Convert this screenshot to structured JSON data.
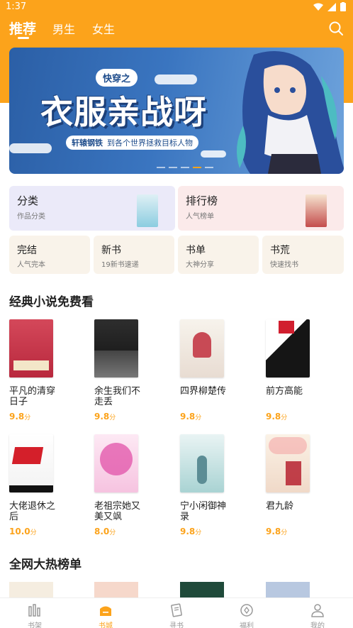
{
  "status_bar": {
    "time": "1:37"
  },
  "top_tabs": [
    {
      "label": "推荐",
      "active": true
    },
    {
      "label": "男生",
      "active": false
    },
    {
      "label": "女生",
      "active": false
    }
  ],
  "banner": {
    "tag": "快穿之",
    "title": "衣服亲战呀",
    "author": "轩辕钢铁",
    "tagline": "到各个世界拯救目标人物"
  },
  "categories": [
    {
      "name": "分类",
      "sub": "作品分类"
    },
    {
      "name": "排行榜",
      "sub": "人气榜单"
    },
    {
      "name": "完结",
      "sub": "人气完本"
    },
    {
      "name": "新书",
      "sub": "19新书速递"
    },
    {
      "name": "书单",
      "sub": "大神分享"
    },
    {
      "name": "书荒",
      "sub": "快速找书"
    }
  ],
  "section1": {
    "title": "经典小说免费看",
    "books": [
      {
        "title": "平凡的清穿日子",
        "score": "9.8",
        "unit": "分"
      },
      {
        "title": "余生我们不走丢",
        "score": "9.8",
        "unit": "分"
      },
      {
        "title": "四界柳楚传",
        "score": "9.8",
        "unit": "分"
      },
      {
        "title": "前方高能",
        "score": "9.8",
        "unit": "分"
      },
      {
        "title": "大佬退休之后",
        "score": "10.0",
        "unit": "分"
      },
      {
        "title": "老祖宗她又美又飒",
        "score": "8.0",
        "unit": "分"
      },
      {
        "title": "宁小闲御神录",
        "score": "9.8",
        "unit": "分"
      },
      {
        "title": "君九龄",
        "score": "9.8",
        "unit": "分"
      }
    ]
  },
  "section2": {
    "title": "全网大热榜单"
  },
  "bottom_nav": [
    {
      "label": "书架",
      "icon": "bookshelf-icon",
      "active": false
    },
    {
      "label": "书城",
      "icon": "bookstore-icon",
      "active": true
    },
    {
      "label": "寻书",
      "icon": "find-book-icon",
      "active": false
    },
    {
      "label": "福利",
      "icon": "welfare-icon",
      "active": false
    },
    {
      "label": "我的",
      "icon": "profile-icon",
      "active": false
    }
  ],
  "colors": {
    "accent": "#fca31b"
  }
}
